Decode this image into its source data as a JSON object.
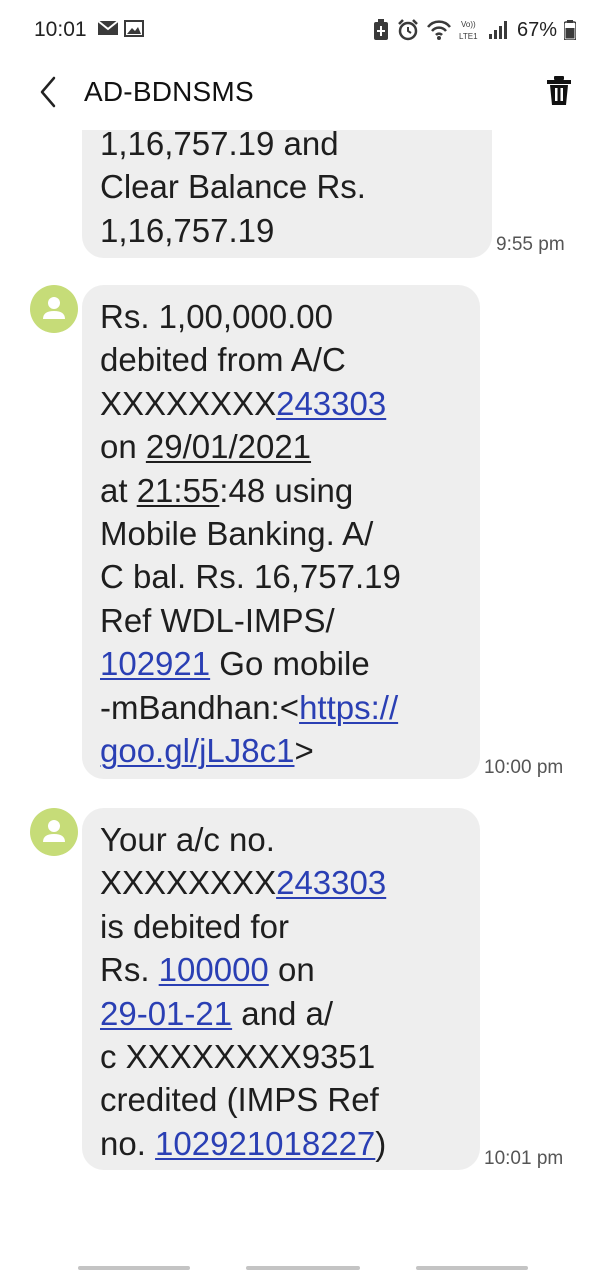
{
  "status_bar": {
    "time": "10:01",
    "battery": "67%",
    "network": "VoLTE LTE1"
  },
  "header": {
    "title": "AD-BDNSMS"
  },
  "messages": [
    {
      "lines": [
        "1,16,757.19 and",
        "Clear Balance Rs.",
        "1,16,757.19"
      ],
      "time": "9:55 pm"
    },
    {
      "line1": "Rs. 1,00,000.00",
      "line2": "debited from A/C",
      "acct_prefix": "XXXXXXXX",
      "acct_link": "243303",
      "on": "on ",
      "date": "29/01/2021",
      "at": "at ",
      "at_time": "21:55",
      "at_rest": ":48 using",
      "line6": "Mobile Banking. A/",
      "line7": "C bal. Rs. 16,757.19",
      "line8": "Ref WDL-IMPS/",
      "ref_link": "102921",
      "ref_rest": " Go mobile",
      "line10_prefix": "-mBandhan:<",
      "url_part1": "https://",
      "url_part2": "goo.gl/jLJ8c1",
      "url_close": ">",
      "time": "10:00 pm"
    },
    {
      "line1": "Your a/c no.",
      "acct_prefix": "XXXXXXXX",
      "acct_link": "243303",
      "line3": "is debited for",
      "rs": "Rs. ",
      "amount_link": "100000",
      "on": " on",
      "date_link": "29-01-21",
      "date_rest": " and a/",
      "line6": "c XXXXXXXX9351",
      "line7": "credited (IMPS Ref",
      "no": "no. ",
      "ref_link": "102921018227",
      "close": ")",
      "time": "10:01 pm"
    }
  ],
  "icons": {
    "back": "back-arrow-icon",
    "delete": "trash-icon",
    "avatar": "contact-avatar-icon"
  },
  "colors": {
    "bubble": "#eeeeee",
    "link": "#2a3fb4",
    "avatar": "#c6dc78"
  }
}
